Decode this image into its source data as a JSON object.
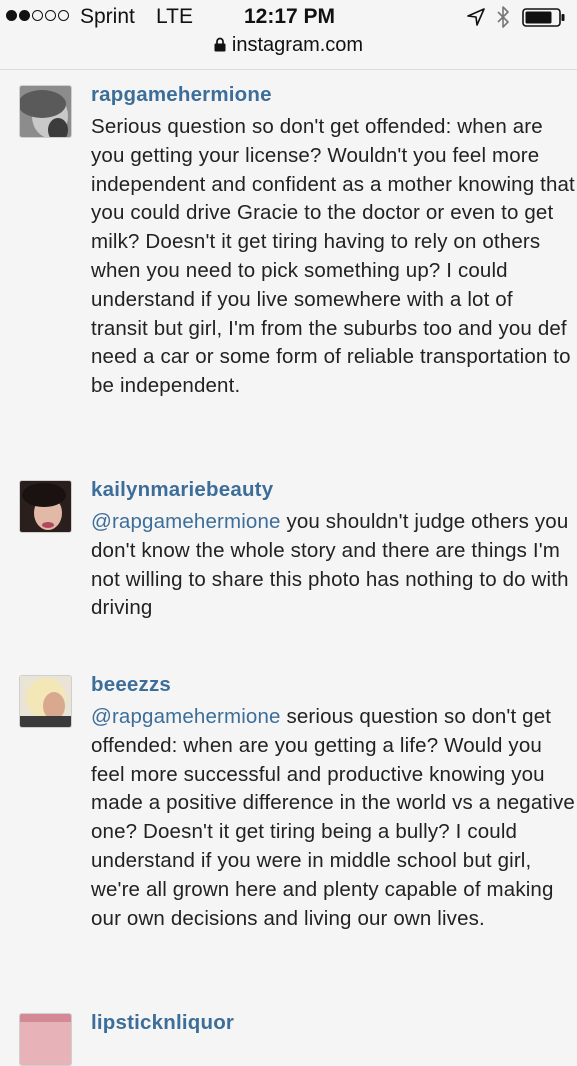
{
  "status_bar": {
    "signal_dots": [
      true,
      true,
      false,
      false,
      false
    ],
    "carrier": "Sprint",
    "network": "LTE",
    "time": "12:17 PM",
    "icons": [
      "location-arrow-icon",
      "bluetooth-icon",
      "battery-icon"
    ]
  },
  "url_bar": {
    "url": "instagram.com",
    "icon": "lock-icon"
  },
  "colors": {
    "username": "#3d6e99",
    "mention": "#3d6e99",
    "text": "#222222",
    "background": "#f5f5f5"
  },
  "comments": [
    {
      "username": "rapgamehermione",
      "mention": "",
      "text": "Serious question so don't get offended: when are you getting your license? Wouldn't you feel more independent and confident as a mother knowing that you could drive Gracie to the doctor or even to get milk? Doesn't it get tiring having to rely on others when you need to pick something up? I could understand if you live somewhere with a lot of transit but girl, I'm from the suburbs too and you def need a car or some form of reliable transportation to be independent."
    },
    {
      "username": "kailynmariebeauty",
      "mention": "@rapgamehermione",
      "text": " you shouldn't judge others you don't know the whole story and there are things I'm not willing to share this photo has nothing to do with driving"
    },
    {
      "username": "beeezzs",
      "mention": "@rapgamehermione",
      "text": " serious question so don't get offended: when are you getting a life? Would you feel more successful and productive knowing you made a positive difference in the world vs a negative one? Doesn't it get tiring being a bully? I could understand if you were in middle school but girl, we're all grown here and plenty capable of making our own decisions and living our own lives."
    },
    {
      "username": "lipsticknliquor",
      "mention": "",
      "text": ""
    }
  ]
}
